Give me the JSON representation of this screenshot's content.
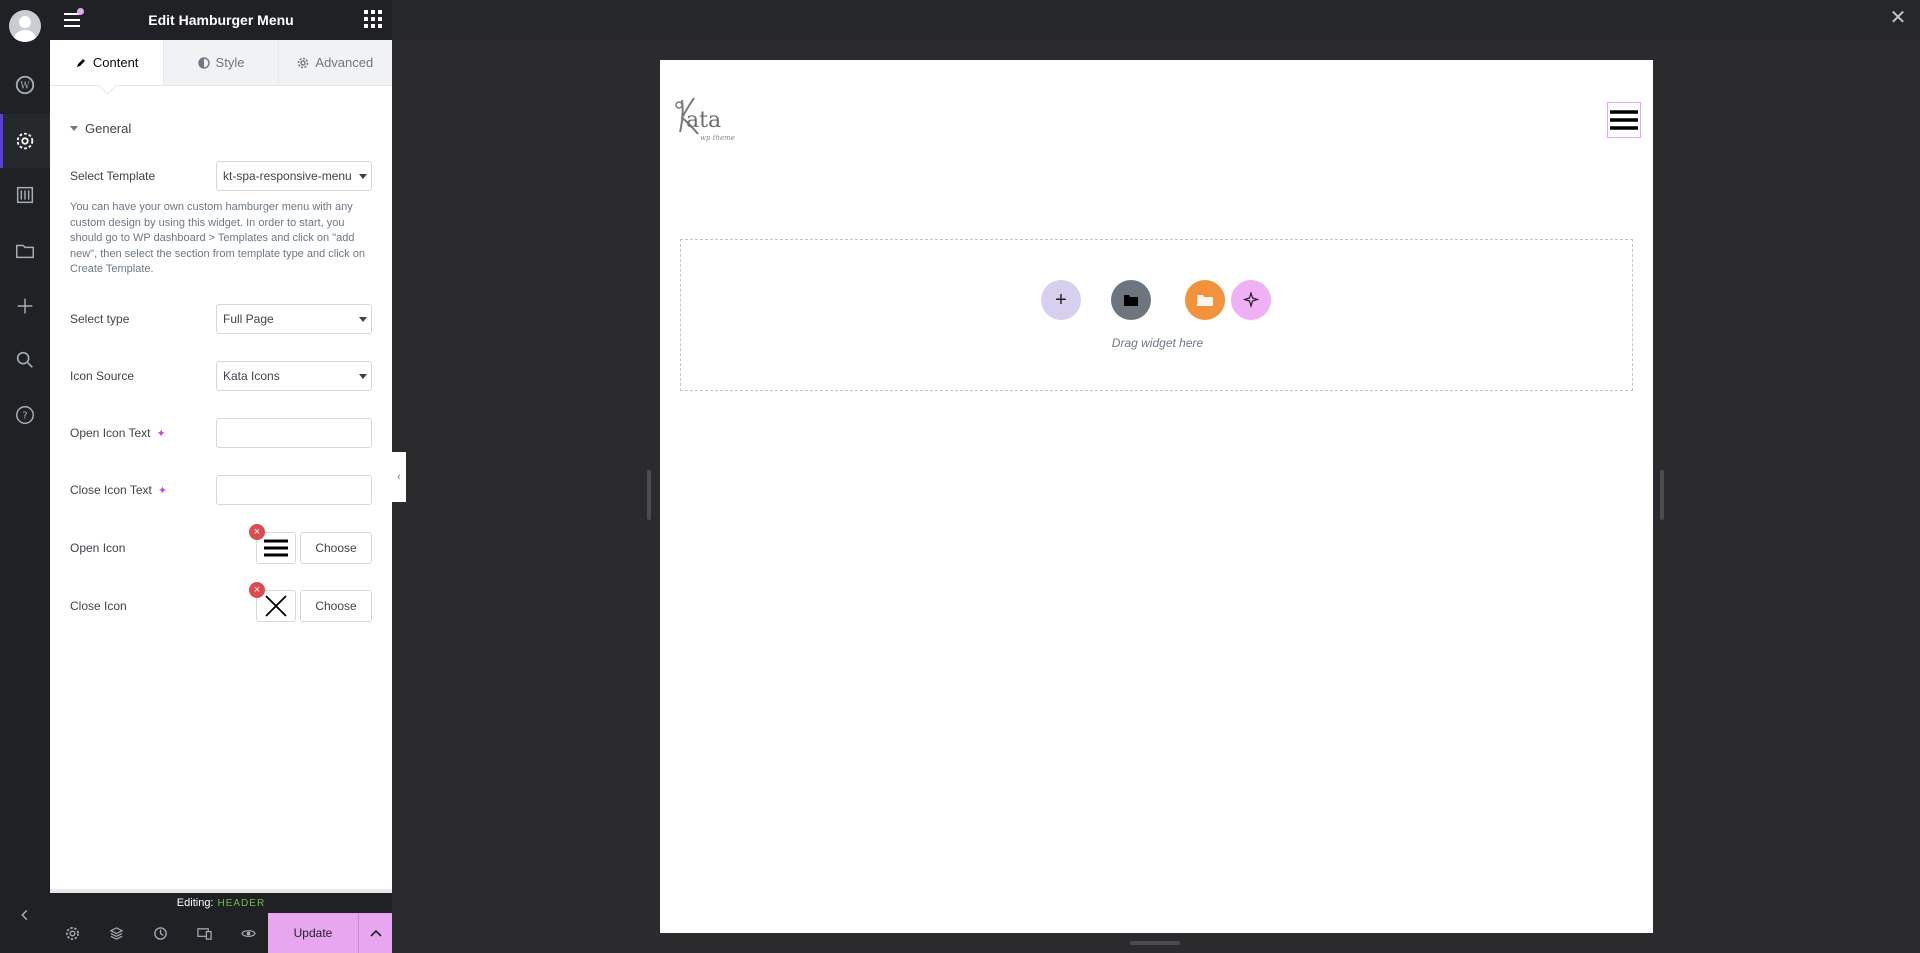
{
  "panel": {
    "title": "Edit Hamburger Menu",
    "tabs": [
      {
        "label": "Content",
        "icon": "pencil-icon"
      },
      {
        "label": "Style",
        "icon": "half-circle-icon"
      },
      {
        "label": "Advanced",
        "icon": "gear-icon"
      }
    ],
    "section": "General",
    "fields": {
      "template_label": "Select Template",
      "template_value": "kt-spa-responsive-menu",
      "description": "You can have your own custom hamburger menu with any custom design by using this widget. In order to start, you should go to WP dashboard > Templates and click on \"add new\", then select the section from template type and click on Create Template.",
      "type_label": "Select type",
      "type_value": "Full Page",
      "icon_source_label": "Icon Source",
      "icon_source_value": "Kata Icons",
      "open_text_label": "Open Icon Text",
      "open_text_value": "",
      "close_text_label": "Close Icon Text",
      "close_text_value": "",
      "open_icon_label": "Open Icon",
      "close_icon_label": "Close Icon",
      "choose_label": "Choose"
    }
  },
  "footer": {
    "editing_label": "Editing:",
    "editing_doc": "HEADER",
    "update_label": "Update"
  },
  "canvas": {
    "logo_text": "ata",
    "logo_sub": "wp theme",
    "drop_text": "Drag widget here"
  },
  "colors": {
    "accent": "#e8a6f1",
    "rail_active": "#5c3cdb",
    "editing_doc": "#6fbe45"
  }
}
